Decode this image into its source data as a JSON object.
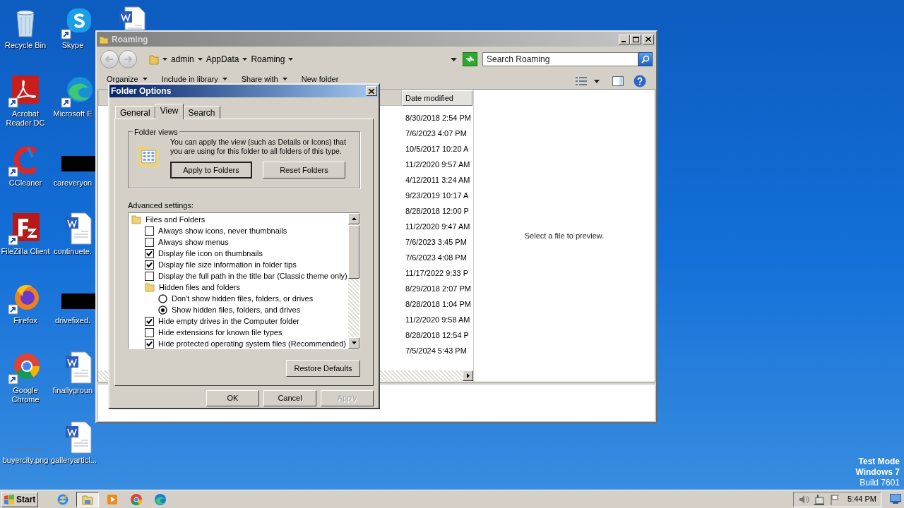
{
  "desktop_icons": [
    {
      "kind": "recycle",
      "label": "Recycle Bin",
      "shortcut": false
    },
    {
      "kind": "skype",
      "label": "Skype",
      "shortcut": true
    },
    {
      "kind": "word",
      "shortcut": false
    },
    {
      "kind": "acrobat",
      "label": "Acrobat Reader DC",
      "shortcut": true
    },
    {
      "kind": "edge",
      "label": "Microsoft E",
      "shortcut": true
    },
    {
      "kind": "ccleaner",
      "label": "CCleaner",
      "shortcut": true
    },
    {
      "kind": "black",
      "label": "careveryon",
      "shortcut": false
    },
    {
      "kind": "filezilla",
      "label": "FileZilla Client",
      "shortcut": true
    },
    {
      "kind": "word",
      "label": "continuete.",
      "shortcut": false
    },
    {
      "kind": "firefox",
      "label": "Firefox",
      "shortcut": true
    },
    {
      "kind": "black",
      "label": "drivefixed.",
      "shortcut": false
    },
    {
      "kind": "chrome",
      "label": "Google Chrome",
      "shortcut": true
    },
    {
      "kind": "word",
      "label": "finallygroun",
      "shortcut": false
    },
    {
      "kind": "image",
      "label": "buyercity.png",
      "shortcut": false
    },
    {
      "kind": "word",
      "label": "galleryarticl...",
      "shortcut": false
    }
  ],
  "explorer": {
    "title": "Roaming",
    "breadcrumb": [
      "admin",
      "AppData",
      "Roaming"
    ],
    "search": {
      "placeholder": "Search Roaming"
    },
    "toolbar": [
      {
        "label": "Organize",
        "menu": true
      },
      {
        "label": "Include in library",
        "menu": true
      },
      {
        "label": "Share with",
        "menu": true
      },
      {
        "label": "New folder",
        "menu": false
      }
    ],
    "columns": [
      "Date modified"
    ],
    "rows": [
      {
        "date_modified": "8/30/2018 2:54 PM"
      },
      {
        "date_modified": "7/6/2023 4:07 PM"
      },
      {
        "date_modified": "10/5/2017 10:20 A"
      },
      {
        "date_modified": "11/2/2020 9:57 AM"
      },
      {
        "date_modified": "4/12/2011 3:24 AM"
      },
      {
        "date_modified": "9/23/2019 10:17 A"
      },
      {
        "date_modified": "8/28/2018 12:00 P"
      },
      {
        "date_modified": "11/2/2020 9:47 AM"
      },
      {
        "date_modified": "7/6/2023 3:45 PM"
      },
      {
        "date_modified": "7/6/2023 4:08 PM"
      },
      {
        "date_modified": "11/17/2022 9:33 P"
      },
      {
        "date_modified": "8/29/2018 2:07 PM"
      },
      {
        "date_modified": "8/28/2018 1:04 PM"
      },
      {
        "date_modified": "11/2/2020 9:58 AM"
      },
      {
        "date_modified": "8/28/2018 12:54 P"
      },
      {
        "date_modified": "7/5/2024 5:43 PM"
      }
    ],
    "preview": "Select a file to preview."
  },
  "dialog": {
    "title": "Folder Options",
    "tabs": [
      {
        "label": "General",
        "selected": false
      },
      {
        "label": "View",
        "selected": true
      },
      {
        "label": "Search",
        "selected": false
      }
    ],
    "folder_views": {
      "legend": "Folder views",
      "text": "You can apply the view (such as Details or Icons) that you are using for this folder to all folders of this type.",
      "buttons": [
        "Apply to Folders",
        "Reset Folders"
      ]
    },
    "advanced_label": "Advanced settings:",
    "settings": [
      {
        "kind": "folder",
        "label": "Files and Folders",
        "children": [
          {
            "kind": "checkbox",
            "label": "Always show icons, never thumbnails",
            "checked": false
          },
          {
            "kind": "checkbox",
            "label": "Always show menus",
            "checked": false
          },
          {
            "kind": "checkbox",
            "label": "Display file icon on thumbnails",
            "checked": true
          },
          {
            "kind": "checkbox",
            "label": "Display file size information in folder tips",
            "checked": true
          },
          {
            "kind": "checkbox",
            "label": "Display the full path in the title bar (Classic theme only)",
            "checked": false
          },
          {
            "kind": "folder",
            "label": "Hidden files and folders",
            "children": [
              {
                "kind": "radio",
                "label": "Don't show hidden files, folders, or drives",
                "selected": false
              },
              {
                "kind": "radio",
                "label": "Show hidden files, folders, and drives",
                "selected": true
              }
            ]
          },
          {
            "kind": "checkbox",
            "label": "Hide empty drives in the Computer folder",
            "checked": true
          },
          {
            "kind": "checkbox",
            "label": "Hide extensions for known file types",
            "checked": false
          },
          {
            "kind": "checkbox",
            "label": "Hide protected operating system files (Recommended)",
            "checked": true
          }
        ]
      }
    ],
    "restore_button": "Restore Defaults",
    "buttons": [
      {
        "label": "OK",
        "disabled": false
      },
      {
        "label": "Cancel",
        "disabled": false
      },
      {
        "label": "Apply",
        "disabled": true
      }
    ]
  },
  "test_mode": [
    {
      "text": "Test Mode",
      "bold": true
    },
    {
      "text": "Windows 7",
      "bold": true
    },
    {
      "text": "Build 7601",
      "bold": false
    }
  ],
  "taskbar": {
    "start": "Start",
    "apps": [
      {
        "kind": "ie",
        "selected": false
      },
      {
        "kind": "explorer",
        "selected": true
      },
      {
        "kind": "media",
        "selected": false
      },
      {
        "kind": "chrome",
        "selected": false
      },
      {
        "kind": "edge",
        "selected": false
      }
    ],
    "tray": [
      {
        "kind": "volume"
      },
      {
        "kind": "network"
      },
      {
        "kind": "flag"
      }
    ],
    "clock": "5:44 PM"
  }
}
